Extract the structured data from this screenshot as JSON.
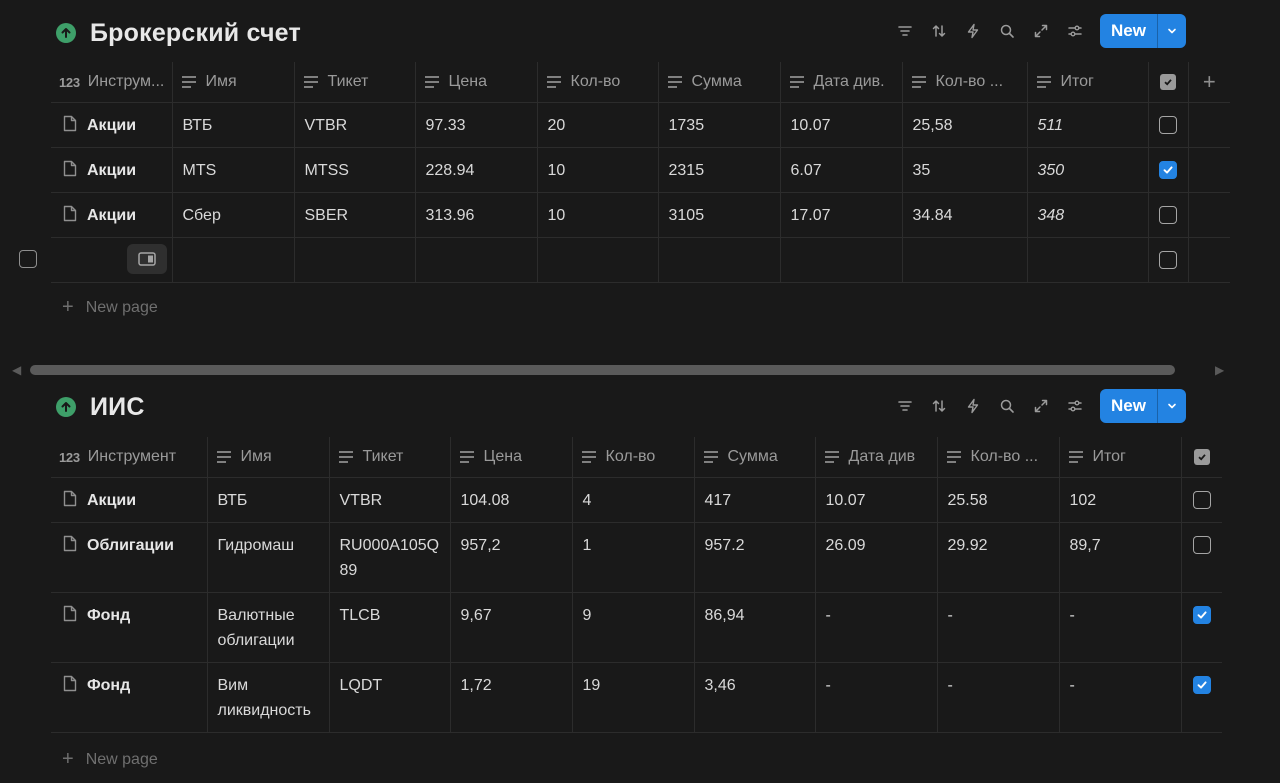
{
  "databases": [
    {
      "title": "Брокерский счет",
      "new_label": "New",
      "columns": [
        {
          "label": "Инструм...",
          "icon": "number-icon"
        },
        {
          "label": "Имя",
          "icon": "text-icon"
        },
        {
          "label": "Тикет",
          "icon": "text-icon"
        },
        {
          "label": "Цена",
          "icon": "text-icon"
        },
        {
          "label": "Кол-во",
          "icon": "text-icon"
        },
        {
          "label": "Сумма",
          "icon": "text-icon"
        },
        {
          "label": "Дата див.",
          "icon": "text-icon"
        },
        {
          "label": "Кол-во ...",
          "icon": "text-icon"
        },
        {
          "label": "Итог",
          "icon": "text-icon"
        }
      ],
      "rows": [
        {
          "instrument": "Акции",
          "name": "ВТБ",
          "ticker": "VTBR",
          "price": "97.33",
          "qty": "20",
          "sum": "1735",
          "div_date": "10.07",
          "div_qty": "25,58",
          "total": "511",
          "checked": false
        },
        {
          "instrument": "Акции",
          "name": "MTS",
          "ticker": "MTSS",
          "price": "228.94",
          "qty": "10",
          "sum": "2315",
          "div_date": "6.07",
          "div_qty": "35",
          "total": "350",
          "checked": true
        },
        {
          "instrument": "Акции",
          "name": "Сбер",
          "ticker": "SBER",
          "price": "313.96",
          "qty": "10",
          "sum": "3105",
          "div_date": "17.07",
          "div_qty": "34.84",
          "total": "348",
          "checked": false
        }
      ],
      "new_page_label": "New page"
    },
    {
      "title": "ИИС",
      "new_label": "New",
      "columns": [
        {
          "label": "Инструмент",
          "icon": "number-icon"
        },
        {
          "label": "Имя",
          "icon": "text-icon"
        },
        {
          "label": "Тикет",
          "icon": "text-icon"
        },
        {
          "label": "Цена",
          "icon": "text-icon"
        },
        {
          "label": "Кол-во",
          "icon": "text-icon"
        },
        {
          "label": "Сумма",
          "icon": "text-icon"
        },
        {
          "label": "Дата див",
          "icon": "text-icon"
        },
        {
          "label": "Кол-во ...",
          "icon": "text-icon"
        },
        {
          "label": "Итог",
          "icon": "text-icon"
        }
      ],
      "rows": [
        {
          "instrument": "Акции",
          "name": "ВТБ",
          "ticker": "VTBR",
          "price": "104.08",
          "qty": "4",
          "sum": "417",
          "div_date": "10.07",
          "div_qty": "25.58",
          "total": "102",
          "checked": false
        },
        {
          "instrument": "Облигации",
          "name": "Гидромаш",
          "ticker": "RU000A105Q89",
          "price": "957,2",
          "qty": "1",
          "sum": "957.2",
          "div_date": "26.09",
          "div_qty": "29.92",
          "total": "89,7",
          "checked": false
        },
        {
          "instrument": "Фонд",
          "name": "Валютные облигации",
          "ticker": "TLCB",
          "price": "9,67",
          "qty": "9",
          "sum": "86,94",
          "div_date": "-",
          "div_qty": "-",
          "total": "-",
          "checked": true
        },
        {
          "instrument": "Фонд",
          "name": "Вим ликвидность",
          "ticker": "LQDT",
          "price": "1,72",
          "qty": "19",
          "sum": "3,46",
          "div_date": "-",
          "div_qty": "-",
          "total": "-",
          "checked": true
        }
      ],
      "new_page_label": "New page"
    }
  ],
  "colors": {
    "accent": "#2383e2",
    "background": "#191919",
    "db_icon": "#3e9f69"
  }
}
